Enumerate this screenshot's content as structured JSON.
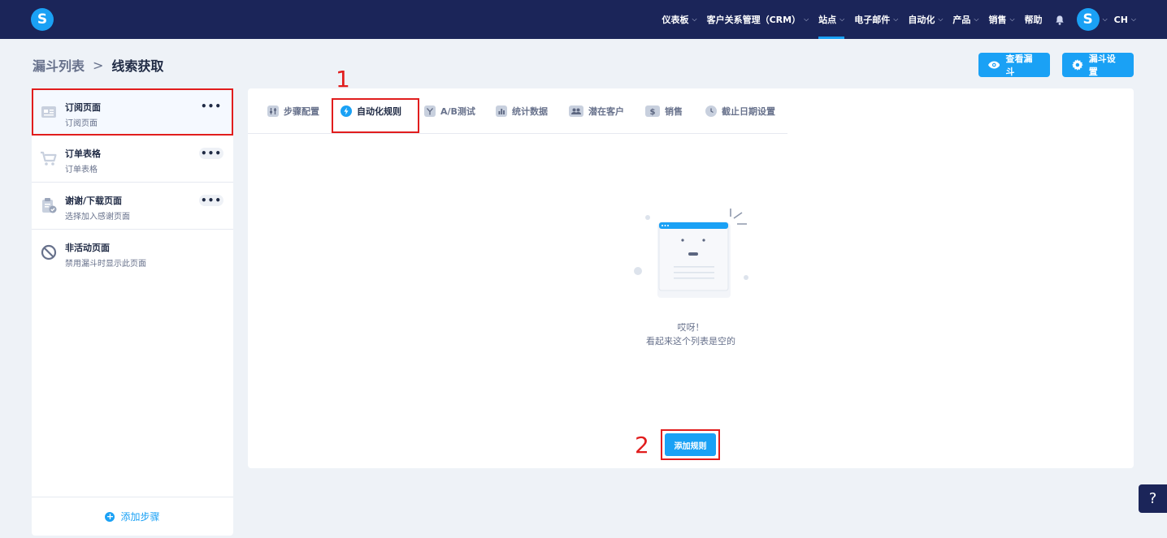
{
  "nav": {
    "items": [
      {
        "label": "仪表板",
        "chevron": true
      },
      {
        "label": "客户关系管理（CRM）",
        "chevron": true
      },
      {
        "label": "站点",
        "chevron": true,
        "active": true
      },
      {
        "label": "电子邮件",
        "chevron": true
      },
      {
        "label": "自动化",
        "chevron": true
      },
      {
        "label": "产品",
        "chevron": true
      },
      {
        "label": "销售",
        "chevron": true
      },
      {
        "label": "帮助",
        "chevron": false
      }
    ],
    "lang": "CH",
    "logo_letter": "S",
    "avatar_letter": "S"
  },
  "breadcrumb": {
    "parent": "漏斗列表",
    "separator": ">",
    "current": "线索获取"
  },
  "header_buttons": {
    "view_funnel": "查看漏斗",
    "funnel_settings": "漏斗设置"
  },
  "sidebar": {
    "steps": [
      {
        "title": "订阅页面",
        "subtitle": "订阅页面",
        "icon": "form-page-icon",
        "selected": true
      },
      {
        "title": "订单表格",
        "subtitle": "订单表格",
        "icon": "cart-icon"
      },
      {
        "title": "谢谢/下载页面",
        "subtitle": "选择加入感谢页面",
        "icon": "clipboard-check-icon"
      },
      {
        "title": "非活动页面",
        "subtitle": "禁用漏斗时显示此页面",
        "icon": "ban-icon"
      }
    ],
    "more_label": "•••",
    "add_step": "添加步骤"
  },
  "tabs": [
    {
      "label": "步骤配置",
      "icon": "sliders-icon"
    },
    {
      "label": "自动化规则",
      "icon": "bolt-icon",
      "active": true
    },
    {
      "label": "A/B测试",
      "icon": "split-icon"
    },
    {
      "label": "统计数据",
      "icon": "bar-chart-icon"
    },
    {
      "label": "潜在客户",
      "icon": "users-icon"
    },
    {
      "label": "销售",
      "icon": "dollar-icon"
    },
    {
      "label": "截止日期设置",
      "icon": "clock-icon"
    }
  ],
  "empty_state": {
    "line1": "哎呀！",
    "line2": "看起来这个列表是空的"
  },
  "add_rule": "添加规则",
  "annotations": {
    "mark1": "1",
    "mark2": "2"
  },
  "help": "?",
  "colors": {
    "nav_bg": "#1b2559",
    "accent": "#1aa1f5",
    "highlight": "#e11d1d"
  }
}
